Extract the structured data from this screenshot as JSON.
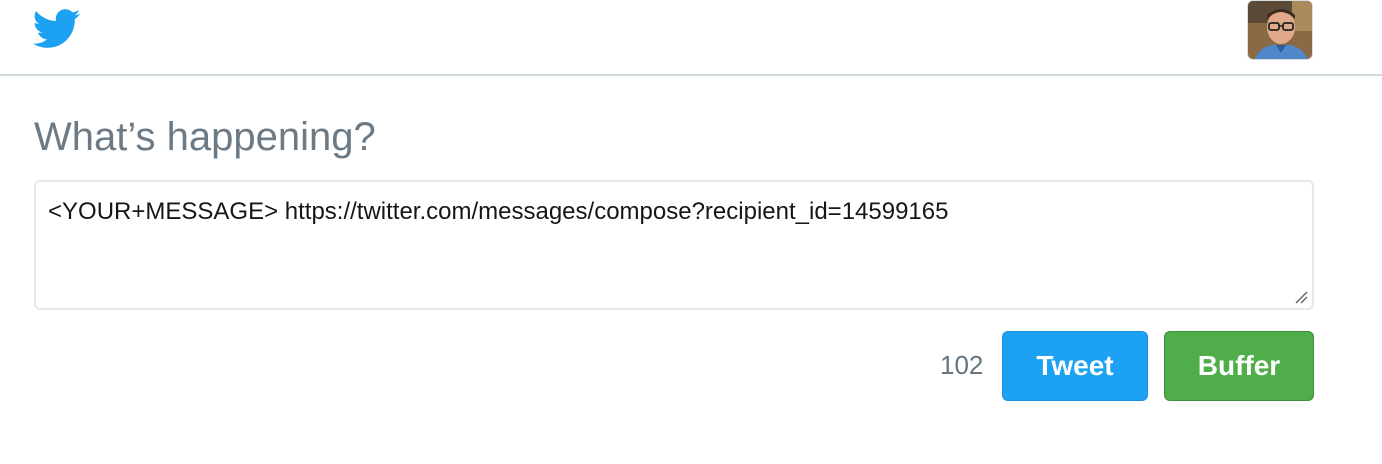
{
  "header": {
    "logo_icon": "twitter-bird-icon",
    "avatar_icon": "user-avatar",
    "brand_color": "#1da1f2"
  },
  "compose": {
    "heading": "What’s happening?",
    "message_text": "<YOUR+MESSAGE> https://twitter.com/messages/compose?recipient_id=14599165",
    "char_count": "102"
  },
  "actions": {
    "tweet_label": "Tweet",
    "tweet_color": "#1da1f2",
    "buffer_label": "Buffer",
    "buffer_color": "#4fae4a"
  }
}
